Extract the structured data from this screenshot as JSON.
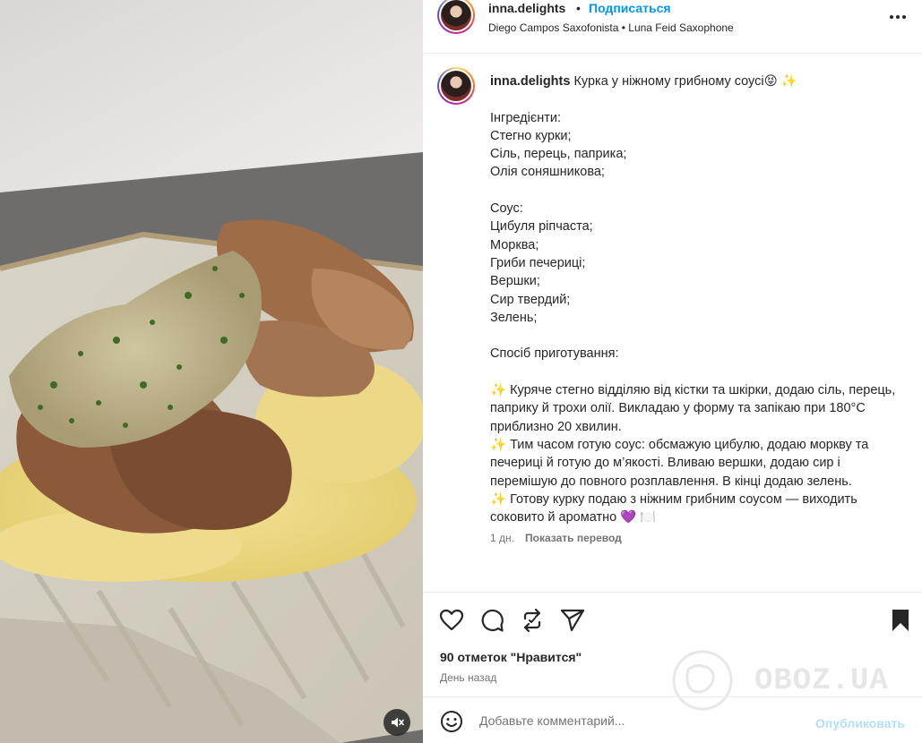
{
  "header": {
    "username": "inna.delights",
    "separator": "•",
    "follow_label": "Подписаться",
    "audio": "Diego Campos Saxofonista • Luna Feid Saxophone",
    "more_icon": "more-horizontal-icon"
  },
  "caption": {
    "username": "inna.delights",
    "text": "Курка у ніжному грибному соусі😝 ✨\n\nІнгредієнти:\nСтегно курки;\nСіль, перець, паприка;\nОлія соняшникова;\n\nСоус:\nЦибуля ріпчаста;\nМорква;\nГриби печериці;\nВершки;\nСир твердий;\nЗелень;\n\nСпосіб приготування:\n\n✨ Куряче стегно відділяю від кістки та шкірки, додаю сіль, перець, паприку й трохи олії. Викладаю у форму та запікаю при 180°C приблизно 20 хвилин.\n✨ Тим часом готую соус: обсмажую цибулю, додаю моркву та печериці й готую до м’якості. Вливаю вершки, додаю сир і перемішую до повного розплавлення. В кінці додаю зелень.\n✨ Готову курку подаю з ніжним грибним соусом — виходить соковито й ароматно 💜 🍽️",
    "age": "1 дн.",
    "translate_label": "Показать перевод"
  },
  "actions": {
    "likes": "90 отметок \"Нравится\"",
    "time": "День назад"
  },
  "comment": {
    "placeholder": "Добавьте комментарий...",
    "publish_label": "Опубликовать"
  },
  "watermark": {
    "text": "OBOZ.UA"
  },
  "colors": {
    "accent": "#0095f6",
    "publish_disabled": "#b2dffc",
    "text": "#262626",
    "secondary": "#737373",
    "divider": "#efefef"
  }
}
